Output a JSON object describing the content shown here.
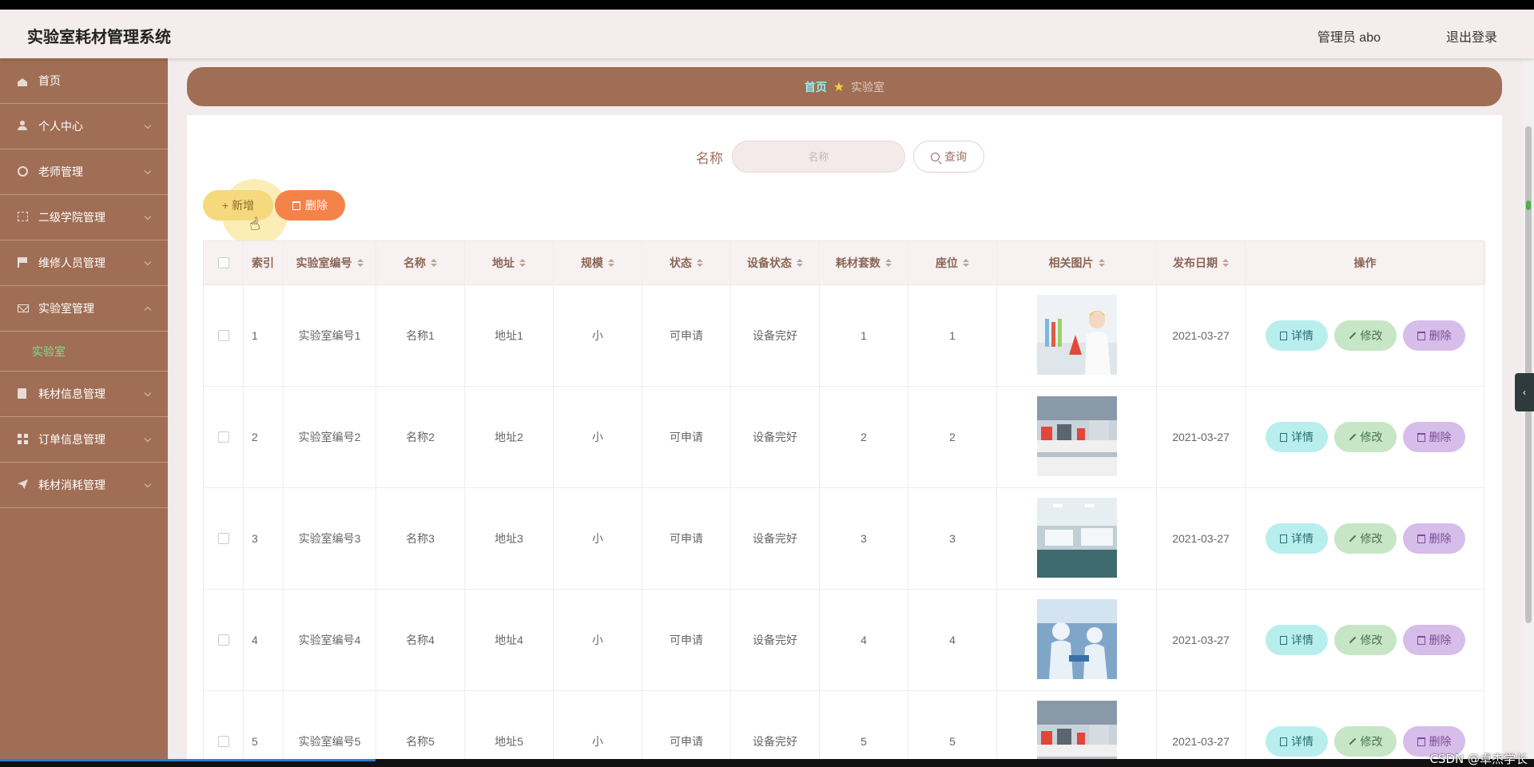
{
  "header": {
    "title": "实验室耗材管理系统",
    "admin": "管理员 abo",
    "logout": "退出登录"
  },
  "sidebar": {
    "items": [
      {
        "label": "首页",
        "icon": "home-icon"
      },
      {
        "label": "个人中心",
        "icon": "user-icon"
      },
      {
        "label": "老师管理",
        "icon": "ring-icon"
      },
      {
        "label": "二级学院管理",
        "icon": "frame-icon"
      },
      {
        "label": "维修人员管理",
        "icon": "flag-icon"
      },
      {
        "label": "实验室管理",
        "icon": "mail-icon",
        "expanded": true,
        "sub": "实验室"
      },
      {
        "label": "耗材信息管理",
        "icon": "clipboard-icon"
      },
      {
        "label": "订单信息管理",
        "icon": "grid-icon"
      },
      {
        "label": "耗材消耗管理",
        "icon": "paper-plane-icon"
      }
    ]
  },
  "breadcrumb": {
    "home": "首页",
    "star": "★",
    "current": "实验室"
  },
  "search": {
    "label": "名称",
    "placeholder": "名称",
    "button": "查询"
  },
  "toolbar": {
    "add": "新增",
    "add_icon": "+",
    "delete": "删除"
  },
  "table": {
    "headers": [
      "索引",
      "实验室编号",
      "名称",
      "地址",
      "规模",
      "状态",
      "设备状态",
      "耗材套数",
      "座位",
      "相关图片",
      "发布日期",
      "操作"
    ],
    "actions": {
      "detail": "详情",
      "edit": "修改",
      "remove": "删除"
    },
    "rows": [
      {
        "index": "1",
        "code": "实验室编号1",
        "name": "名称1",
        "address": "地址1",
        "scale": "小",
        "status": "可申请",
        "equip": "设备完好",
        "sets": "1",
        "seats": "1",
        "date": "2021-03-27",
        "image": "scientist-photo"
      },
      {
        "index": "2",
        "code": "实验室编号2",
        "name": "名称2",
        "address": "地址2",
        "scale": "小",
        "status": "可申请",
        "equip": "设备完好",
        "sets": "2",
        "seats": "2",
        "date": "2021-03-27",
        "image": "lab-bench-photo"
      },
      {
        "index": "3",
        "code": "实验室编号3",
        "name": "名称3",
        "address": "地址3",
        "scale": "小",
        "status": "可申请",
        "equip": "设备完好",
        "sets": "3",
        "seats": "3",
        "date": "2021-03-27",
        "image": "lab-room-photo"
      },
      {
        "index": "4",
        "code": "实验室编号4",
        "name": "名称4",
        "address": "地址4",
        "scale": "小",
        "status": "可申请",
        "equip": "设备完好",
        "sets": "4",
        "seats": "4",
        "date": "2021-03-27",
        "image": "cleanroom-photo"
      },
      {
        "index": "5",
        "code": "实验室编号5",
        "name": "名称5",
        "address": "地址5",
        "scale": "小",
        "status": "可申请",
        "equip": "设备完好",
        "sets": "5",
        "seats": "5",
        "date": "2021-03-27",
        "image": "lab-bench-photo"
      }
    ]
  },
  "watermark": "CSDN @卓杰学长",
  "side_toggle": "‹",
  "colors": {
    "sidebar": "#a06e55",
    "accent_text": "#a07060",
    "active_sub": "#7ee08a"
  }
}
